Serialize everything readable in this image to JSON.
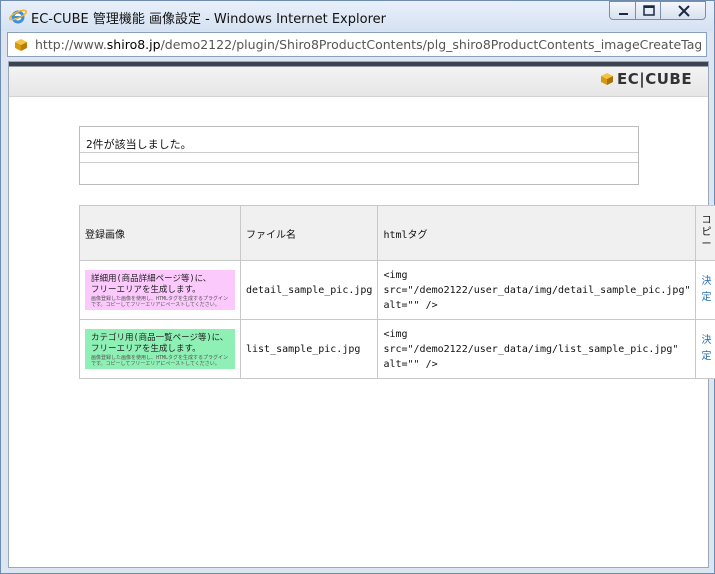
{
  "window": {
    "title": "EC-CUBE 管理機能 画像設定 - Windows Internet Explorer",
    "address_prefix": "http://www.",
    "address_host": "shiro8.jp",
    "address_rest": "/demo2122/plugin/Shiro8ProductContents/plg_shiro8ProductContents_imageCreateTag.php"
  },
  "logo": {
    "text": "EC|CUBE"
  },
  "message": {
    "result_text": "2件が該当しました。"
  },
  "table": {
    "headers": {
      "image": "登録画像",
      "filename": "ファイル名",
      "html_tag": "htmlタグ",
      "copy": "コピー"
    },
    "rows": [
      {
        "thumb_line1": "詳細用(商品詳細ページ等)に、",
        "thumb_line2": "フリーエリアを生成します。",
        "thumb_small": "画像登録した画像を使用し、HTMLタグを生成するプラグインです。コピーしてフリーエリアにペーストしてください。",
        "filename": "detail_sample_pic.jpg",
        "tag_line1": "<img",
        "tag_line2": "src=\"/demo2122/user_data/img/detail_sample_pic.jpg\"",
        "tag_line3": "alt=\"\" />",
        "action": "決定",
        "color": "#fbc9fb"
      },
      {
        "thumb_line1": "カテゴリ用(商品一覧ページ等)に、",
        "thumb_line2": "フリーエリアを生成します。",
        "thumb_small": "画像登録した画像を使用し、HTMLタグを生成するプラグインです。コピーしてフリーエリアにペーストしてください。",
        "filename": "list_sample_pic.jpg",
        "tag_line1": "<img",
        "tag_line2": "src=\"/demo2122/user_data/img/list_sample_pic.jpg\"",
        "tag_line3": "alt=\"\" />",
        "action": "決定",
        "color": "#8ef0b4"
      }
    ]
  },
  "icons": [
    "ie-icon",
    "page-icon",
    "minimize-icon",
    "maximize-icon",
    "close-icon",
    "ec-cube-logo-icon"
  ]
}
